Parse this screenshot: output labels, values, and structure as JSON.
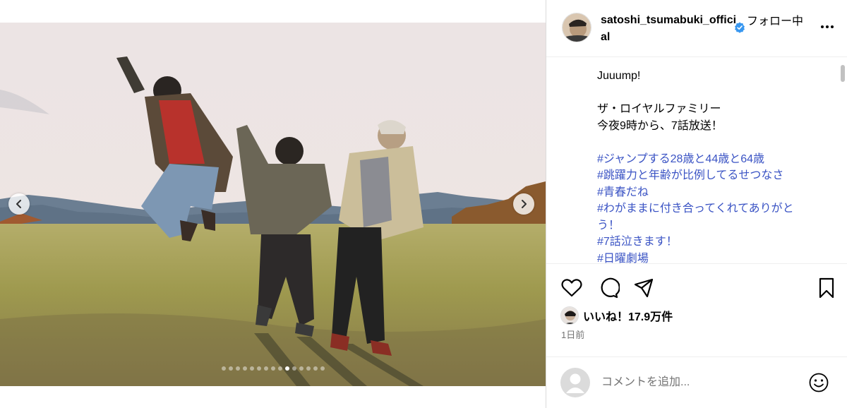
{
  "post": {
    "slide_count": 15,
    "active_slide": 9
  },
  "header": {
    "username": "satoshi_tsumabuki_official",
    "follow_status": "フォロー中"
  },
  "caption": {
    "lines": [
      {
        "text": "Juuump!",
        "tag": false
      },
      {
        "text": "",
        "tag": false
      },
      {
        "text": "ザ・ロイヤルファミリー",
        "tag": false
      },
      {
        "text": "今夜9時から、7話放送！",
        "tag": false
      },
      {
        "text": "",
        "tag": false
      },
      {
        "text": "#ジャンプする28歳と44歳と64歳",
        "tag": true
      },
      {
        "text": "#跳躍力と年齢が比例してるせつなさ",
        "tag": true
      },
      {
        "text": "#青春だね",
        "tag": true
      },
      {
        "text": "#わがままに付き合ってくれてありがとう！",
        "tag": true,
        "text2": "う！",
        "text1": "#わがままに付き合ってくれてありがと"
      },
      {
        "text": "#7話泣きます！",
        "tag": true
      },
      {
        "text": "#日曜劇場",
        "tag": true
      }
    ]
  },
  "actions": {
    "like_icon": "heart-icon",
    "comment_icon": "comment-icon",
    "share_icon": "share-icon",
    "save_icon": "bookmark-icon"
  },
  "likes": {
    "text": "いいね！17.9万件"
  },
  "time_ago": "1日前",
  "comment": {
    "placeholder": "コメントを追加..."
  },
  "colors": {
    "hashtag": "#3a53c4",
    "verified": "#3897f0",
    "muted": "#737373"
  }
}
